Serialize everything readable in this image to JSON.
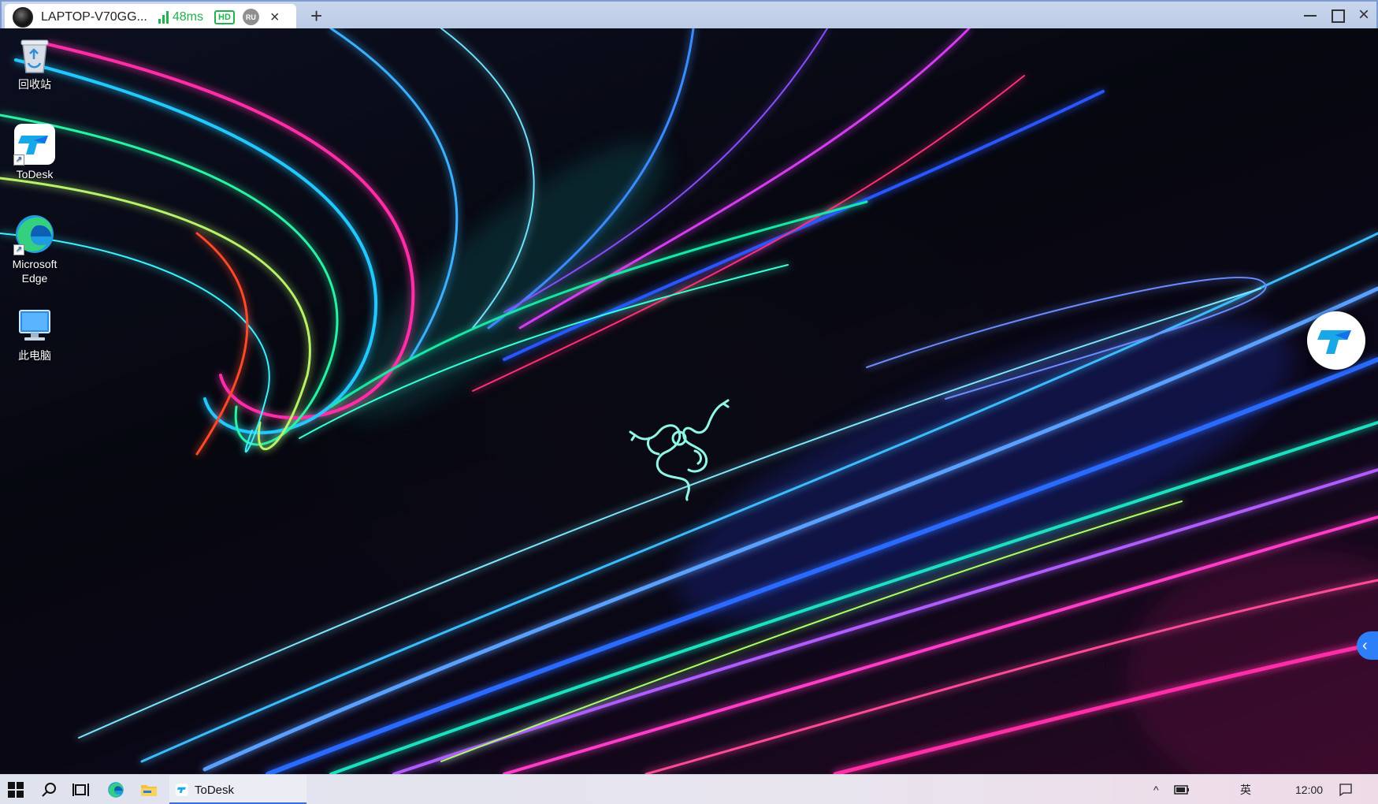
{
  "window": {
    "tab_title": "LAPTOP-V70GG...",
    "latency": "48ms",
    "quality_badge": "HD",
    "user_badge": "RU",
    "close_tab_label": "×",
    "new_tab_label": "+",
    "minimize_icon": "minimize-icon",
    "maximize_icon": "maximize-icon",
    "close_label": "×"
  },
  "desktop_icons": [
    {
      "label": "回收站",
      "icon": "recycle-bin-icon"
    },
    {
      "label": "ToDesk",
      "icon": "todesk-icon"
    },
    {
      "label": "Microsoft Edge",
      "icon": "edge-icon"
    },
    {
      "label": "此电脑",
      "icon": "computer-icon"
    }
  ],
  "floating": {
    "todesk_button_icon": "todesk-icon",
    "side_handle_label": "‹"
  },
  "taskbar": {
    "start_icon": "windows-start-icon",
    "search_icon": "search-icon",
    "task_view_icon": "task-view-icon",
    "edge_icon": "edge-icon",
    "explorer_icon": "folder-icon",
    "running_app_label": "ToDesk",
    "tray": {
      "chevron": "^",
      "battery_icon": "battery-icon",
      "input_lang": "英",
      "clock": "12:00"
    }
  },
  "colors": {
    "titlebar": "#c9d6ec",
    "accent_green": "#22b14c",
    "todesk_blue": "#2d7ff9",
    "taskbar": "#e3e6ef"
  }
}
